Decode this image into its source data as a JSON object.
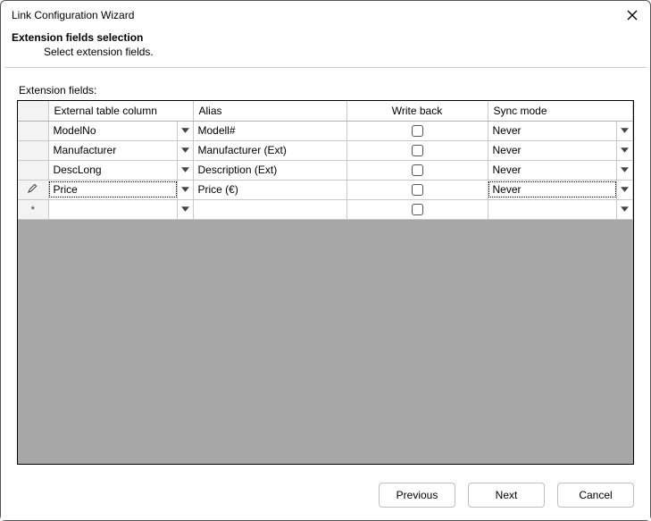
{
  "window": {
    "title": "Link Configuration Wizard"
  },
  "header": {
    "heading": "Extension fields selection",
    "sub": "Select extension fields."
  },
  "content": {
    "grid_label": "Extension fields:",
    "columns": {
      "ext": "External table column",
      "alias": "Alias",
      "writeback": "Write back",
      "sync": "Sync mode"
    },
    "rows": [
      {
        "marker": "",
        "ext": "ModelNo",
        "alias": "Modell#",
        "writeback": false,
        "sync": "Never",
        "editing": false
      },
      {
        "marker": "",
        "ext": "Manufacturer",
        "alias": "Manufacturer (Ext)",
        "writeback": false,
        "sync": "Never",
        "editing": false
      },
      {
        "marker": "",
        "ext": "DescLong",
        "alias": "Description (Ext)",
        "writeback": false,
        "sync": "Never",
        "editing": false
      },
      {
        "marker": "edit",
        "ext": "Price",
        "alias": "Price (€)",
        "writeback": false,
        "sync": "Never",
        "editing": true
      },
      {
        "marker": "new",
        "ext": "",
        "alias": "",
        "writeback": false,
        "sync": "",
        "editing": false
      }
    ]
  },
  "footer": {
    "previous": "Previous",
    "next": "Next",
    "cancel": "Cancel"
  }
}
